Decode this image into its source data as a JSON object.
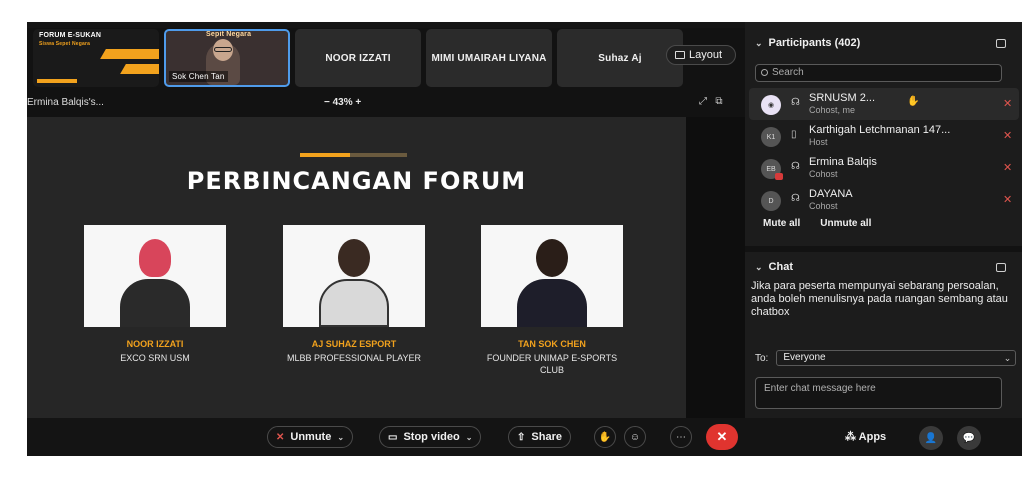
{
  "thumbnails": {
    "forum_label": "FORUM E-SUKAN",
    "forum_sub": "Siswa Sepet Negara",
    "video_banner": "Sepit Negara",
    "video_name": "Sok Chen Tan",
    "tiles": [
      "NOOR IZZATI",
      "MIMI UMAIRAH LIYANA",
      "Suhaz Aj"
    ]
  },
  "layout_label": "Layout",
  "share": {
    "presenter": "Ermina Balqis's...",
    "zoom": "−  43%  +"
  },
  "slide": {
    "title": "PERBINCANGAN FORUM",
    "speakers": [
      {
        "name": "NOOR IZZATI",
        "role": "EXCO SRN USM"
      },
      {
        "name": "AJ SUHAZ ESPORT",
        "role": "MLBB PROFESSIONAL PLAYER"
      },
      {
        "name": "TAN SOK CHEN",
        "role": "FOUNDER UNIMAP E-SPORTS CLUB"
      }
    ]
  },
  "participants": {
    "title": "Participants (402)",
    "search_placeholder": "Search",
    "list": [
      {
        "initials": "",
        "name": "SRNUSM 2...",
        "role": "Cohost, me"
      },
      {
        "initials": "K1",
        "name": "Karthigah Letchmanan 147...",
        "role": "Host"
      },
      {
        "initials": "EB",
        "name": "Ermina Balqis",
        "role": "Cohost"
      },
      {
        "initials": "D",
        "name": "DAYANA",
        "role": "Cohost"
      }
    ],
    "mute_all": "Mute all",
    "unmute_all": "Unmute all"
  },
  "chat": {
    "title": "Chat",
    "message": "Jika para peserta mempunyai sebarang persoalan, anda boleh menulisnya pada ruangan sembang atau chatbox",
    "to_label": "To:",
    "to_value": "Everyone",
    "input_placeholder": "Enter chat message here"
  },
  "controls": {
    "unmute": "Unmute",
    "stop_video": "Stop video",
    "share": "Share",
    "apps": "Apps"
  },
  "colors": {
    "accent_orange": "#f2a21d",
    "end_red": "#e0342f",
    "selected_blue": "#4f9bea"
  }
}
